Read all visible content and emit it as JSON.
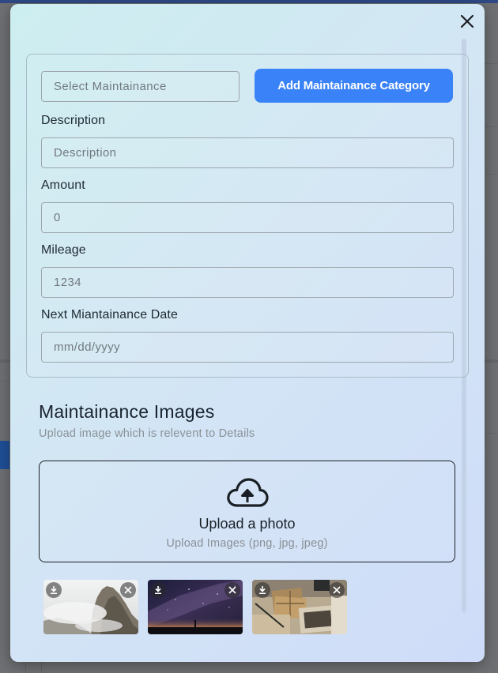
{
  "modal": {
    "close_icon": "close-icon"
  },
  "form": {
    "maintenance_select": {
      "placeholder": "Select Maintainance"
    },
    "add_category_button": "Add Maintainance Category",
    "description": {
      "label": "Description",
      "placeholder": "Description"
    },
    "amount": {
      "label": "Amount",
      "placeholder": "0"
    },
    "mileage": {
      "label": "Mileage",
      "placeholder": "1234"
    },
    "next_date": {
      "label": "Next Miantainance Date",
      "placeholder": "mm/dd/yyyy"
    }
  },
  "images_section": {
    "title": "Maintainance Images",
    "subtitle": "Upload image which is relevent to Details",
    "upload": {
      "title": "Upload a photo",
      "hint": "Upload Images (png, jpg, jpeg)",
      "icon": "cloud-upload-icon"
    },
    "thumbnails": [
      {
        "name": "foggy-cliff-thumbnail",
        "icons": [
          "download-icon",
          "close-icon"
        ]
      },
      {
        "name": "night-sky-thumbnail",
        "icons": [
          "download-icon",
          "close-icon"
        ]
      },
      {
        "name": "vintage-letters-thumbnail",
        "icons": [
          "download-icon",
          "close-icon"
        ]
      }
    ]
  },
  "colors": {
    "accent": "#3a82f7",
    "modal_gradient_start": "#cdeef0",
    "modal_gradient_end": "#cfdcf9"
  }
}
